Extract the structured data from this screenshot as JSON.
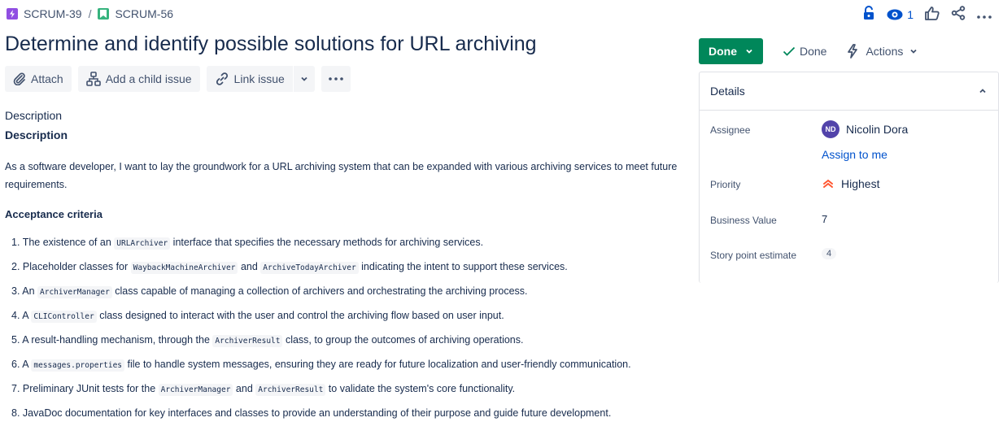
{
  "breadcrumb": {
    "parent": "SCRUM-39",
    "separator": "/",
    "current": "SCRUM-56"
  },
  "header": {
    "watchers_count": "1"
  },
  "issue": {
    "title": "Determine and identify possible solutions for URL archiving"
  },
  "toolbar": {
    "attach": "Attach",
    "add_child": "Add a child issue",
    "link_issue": "Link issue"
  },
  "description": {
    "section_label": "Description",
    "heading": "Description",
    "body": "As a software developer, I want to lay the groundwork for a URL archiving system that can be expanded with various archiving services to meet future requirements.",
    "acceptance_heading": "Acceptance criteria",
    "criteria": [
      {
        "n": "1.",
        "a": "The existence of an ",
        "c1": "URLArchiver",
        "b": " interface that specifies the necessary methods for archiving services.",
        "c2": "",
        "d": ""
      },
      {
        "n": "2.",
        "a": "Placeholder classes for ",
        "c1": "WaybackMachineArchiver",
        "b": " and ",
        "c2": "ArchiveTodayArchiver",
        "d": " indicating the intent to support these services."
      },
      {
        "n": "3.",
        "a": "An ",
        "c1": "ArchiverManager",
        "b": " class capable of managing a collection of archivers and orchestrating the archiving process.",
        "c2": "",
        "d": ""
      },
      {
        "n": "4.",
        "a": "A ",
        "c1": "CLIController",
        "b": " class designed to interact with the user and control the archiving flow based on user input.",
        "c2": "",
        "d": ""
      },
      {
        "n": "5.",
        "a": "A result-handling mechanism, through the ",
        "c1": "ArchiverResult",
        "b": " class, to group the outcomes of archiving operations.",
        "c2": "",
        "d": ""
      },
      {
        "n": "6.",
        "a": "A ",
        "c1": "messages.properties",
        "b": " file to handle system messages, ensuring they are ready for future localization and user-friendly communication.",
        "c2": "",
        "d": ""
      },
      {
        "n": "7.",
        "a": "Preliminary JUnit tests for the ",
        "c1": "ArchiverManager",
        "b": " and ",
        "c2": "ArchiverResult",
        "d": " to validate the system's core functionality."
      },
      {
        "n": "8.",
        "a": "JavaDoc documentation for key interfaces and classes to provide an understanding of their purpose and guide future development.",
        "c1": "",
        "b": "",
        "c2": "",
        "d": ""
      }
    ]
  },
  "status": {
    "button": "Done",
    "resolution": "Done",
    "actions": "Actions"
  },
  "details": {
    "heading": "Details",
    "assignee_label": "Assignee",
    "assignee_initials": "ND",
    "assignee_name": "Nicolin Dora",
    "assign_to_me": "Assign to me",
    "priority_label": "Priority",
    "priority_value": "Highest",
    "business_value_label": "Business Value",
    "business_value": "7",
    "story_points_label": "Story point estimate",
    "story_points": "4"
  },
  "colors": {
    "status_green": "#00875a",
    "link_blue": "#0052cc",
    "priority_red": "#ff5630",
    "avatar_purple": "#5243aa"
  }
}
